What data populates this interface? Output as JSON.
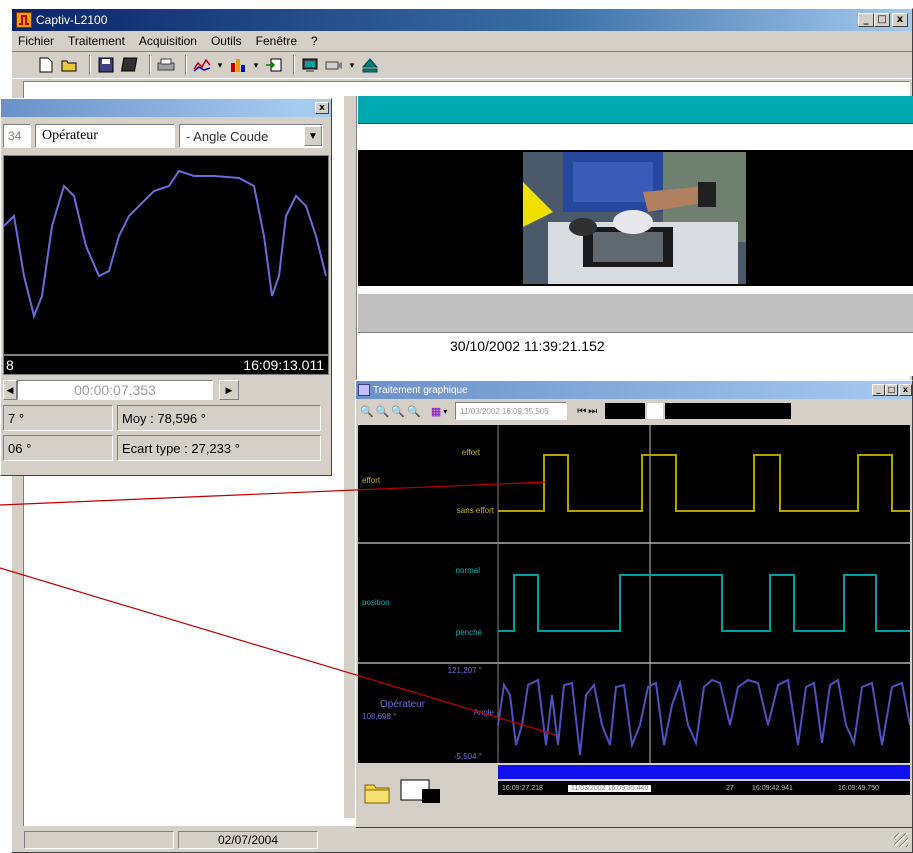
{
  "app": {
    "title": "Captiv-L2100"
  },
  "menu": [
    "Fichier",
    "Traitement",
    "Acquisition",
    "Outils",
    "Fenêtre",
    "?"
  ],
  "icons": [
    "new-file-icon",
    "open-folder-icon",
    "save-icon",
    "save-all-icon",
    "print-icon",
    "chart-line-icon",
    "chart-bar-icon",
    "export-icon",
    "sensor-icon",
    "camera-icon",
    "eject-icon"
  ],
  "left_panel": {
    "value_partial": "34",
    "channel_label": "Opérateur",
    "dropdown_value": "- Angle Coude",
    "time_left_partial": "8",
    "time_right": "16:09:13.011",
    "duration": "00:00:07.353",
    "stat_left_1": "7 °",
    "stat_moy": "Moy : 78,596 °",
    "stat_left_2": "06 °",
    "stat_ecart": "Ecart type : 27,233 °"
  },
  "video_panel": {
    "timestamp": "30/10/2002 11:39:21.152"
  },
  "graph_window": {
    "title": "Traitement graphique",
    "toolbar_time": "11/03/2002 16:09:35.505",
    "track1": {
      "label": "effort",
      "top": "effort",
      "bottom": "sans effort"
    },
    "track2": {
      "label": "position",
      "top": "normal",
      "bottom": "penché"
    },
    "track3": {
      "label": "Opérateur",
      "max": "121,207 °",
      "mid": "108,698 °",
      "name": "Angle",
      "min": "-5,504 °"
    },
    "timeline": [
      "16:09:27.218",
      "11/03/2002 16:09:35.440",
      "27",
      "16:09:42.941",
      "16:09:49.750"
    ]
  },
  "status": {
    "date": "02/07/2004"
  }
}
